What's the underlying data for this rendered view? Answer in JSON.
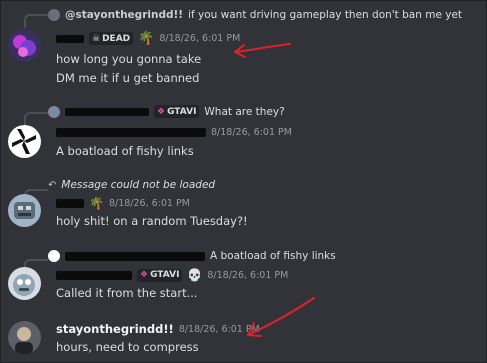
{
  "messages": [
    {
      "reply": {
        "user": "@stayonthegrindd!!",
        "text": "if you want driving gameplay then don't ban me yet"
      },
      "tag": "DEAD",
      "timestamp": "8/18/26, 6:01 PM",
      "lines": [
        "how long you gonna take",
        "DM me it if u get banned"
      ]
    },
    {
      "reply": {
        "tag": "GTAVI",
        "text": "What are they?"
      },
      "timestamp": "8/18/26, 6:01 PM",
      "lines": [
        "A boatload of fishy links"
      ]
    },
    {
      "reply": {
        "text": "Message could not be loaded"
      },
      "timestamp": "8/18/26, 6:01 PM",
      "lines": [
        "holy shit! on a random Tuesday?!"
      ]
    },
    {
      "reply": {
        "text": "A boatload of fishy links"
      },
      "tag": "GTAVI",
      "timestamp": "8/18/26, 6:01 PM",
      "lines": [
        "Called it from the start..."
      ]
    },
    {
      "username": "stayonthegrindd!!",
      "timestamp": "8/18/26, 6:01 PM",
      "lines": [
        "hours, need to compress"
      ]
    }
  ],
  "colors": {
    "background": "#313338",
    "annotation_arrow": "#e0212b"
  }
}
